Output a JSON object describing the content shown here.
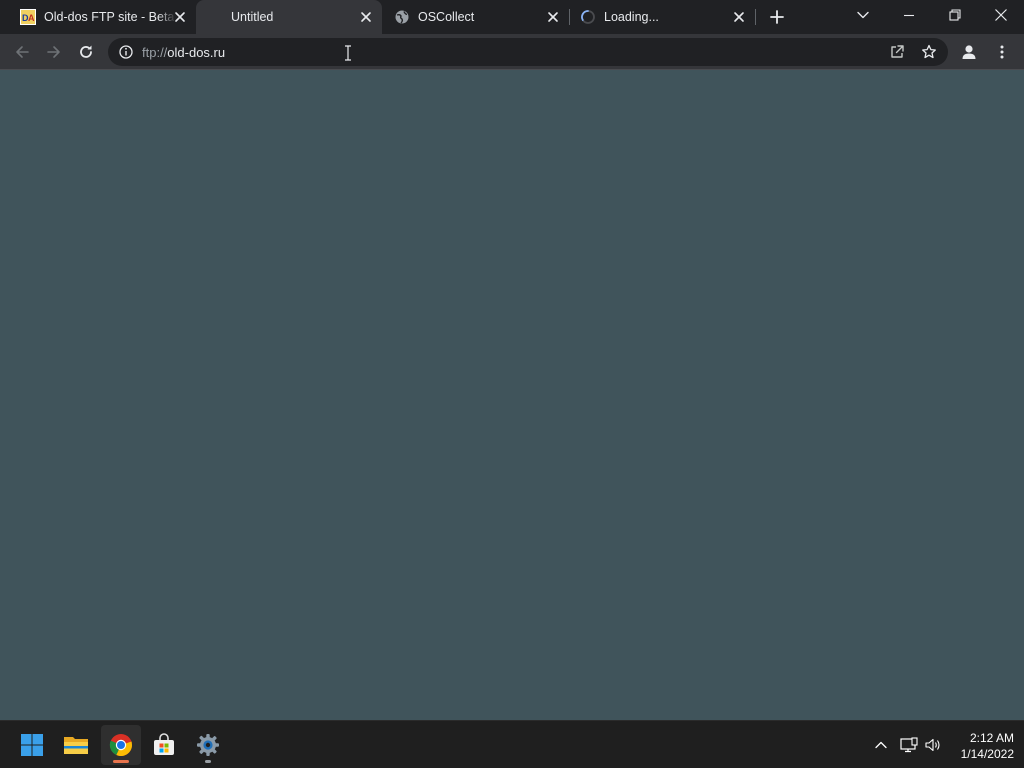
{
  "browser": {
    "tabs": [
      {
        "title": "Old-dos FTP site - Beta",
        "favicon": "old-dos-logo-icon",
        "state": "inactive"
      },
      {
        "title": "Untitled",
        "favicon": "none",
        "state": "active"
      },
      {
        "title": "OSCollect",
        "favicon": "globe-icon",
        "state": "inactive"
      },
      {
        "title": "Loading...",
        "favicon": "loading-spinner-icon",
        "state": "loading"
      }
    ],
    "omnibox": {
      "scheme": "ftp://",
      "host": "old-dos.ru"
    }
  },
  "content": {
    "background_color": "#40545b"
  },
  "taskbar": {
    "apps": [
      {
        "name": "start-icon"
      },
      {
        "name": "file-explorer-icon"
      },
      {
        "name": "chrome-icon",
        "active": true
      },
      {
        "name": "microsoft-store-icon"
      },
      {
        "name": "settings-icon",
        "running": true
      }
    ],
    "clock": {
      "time": "2:12 AM",
      "date": "1/14/2022"
    }
  },
  "colors": {
    "titlebar": "#202124",
    "toolbar": "#35363a",
    "accent_chrome_indicator": "#e8744d"
  }
}
